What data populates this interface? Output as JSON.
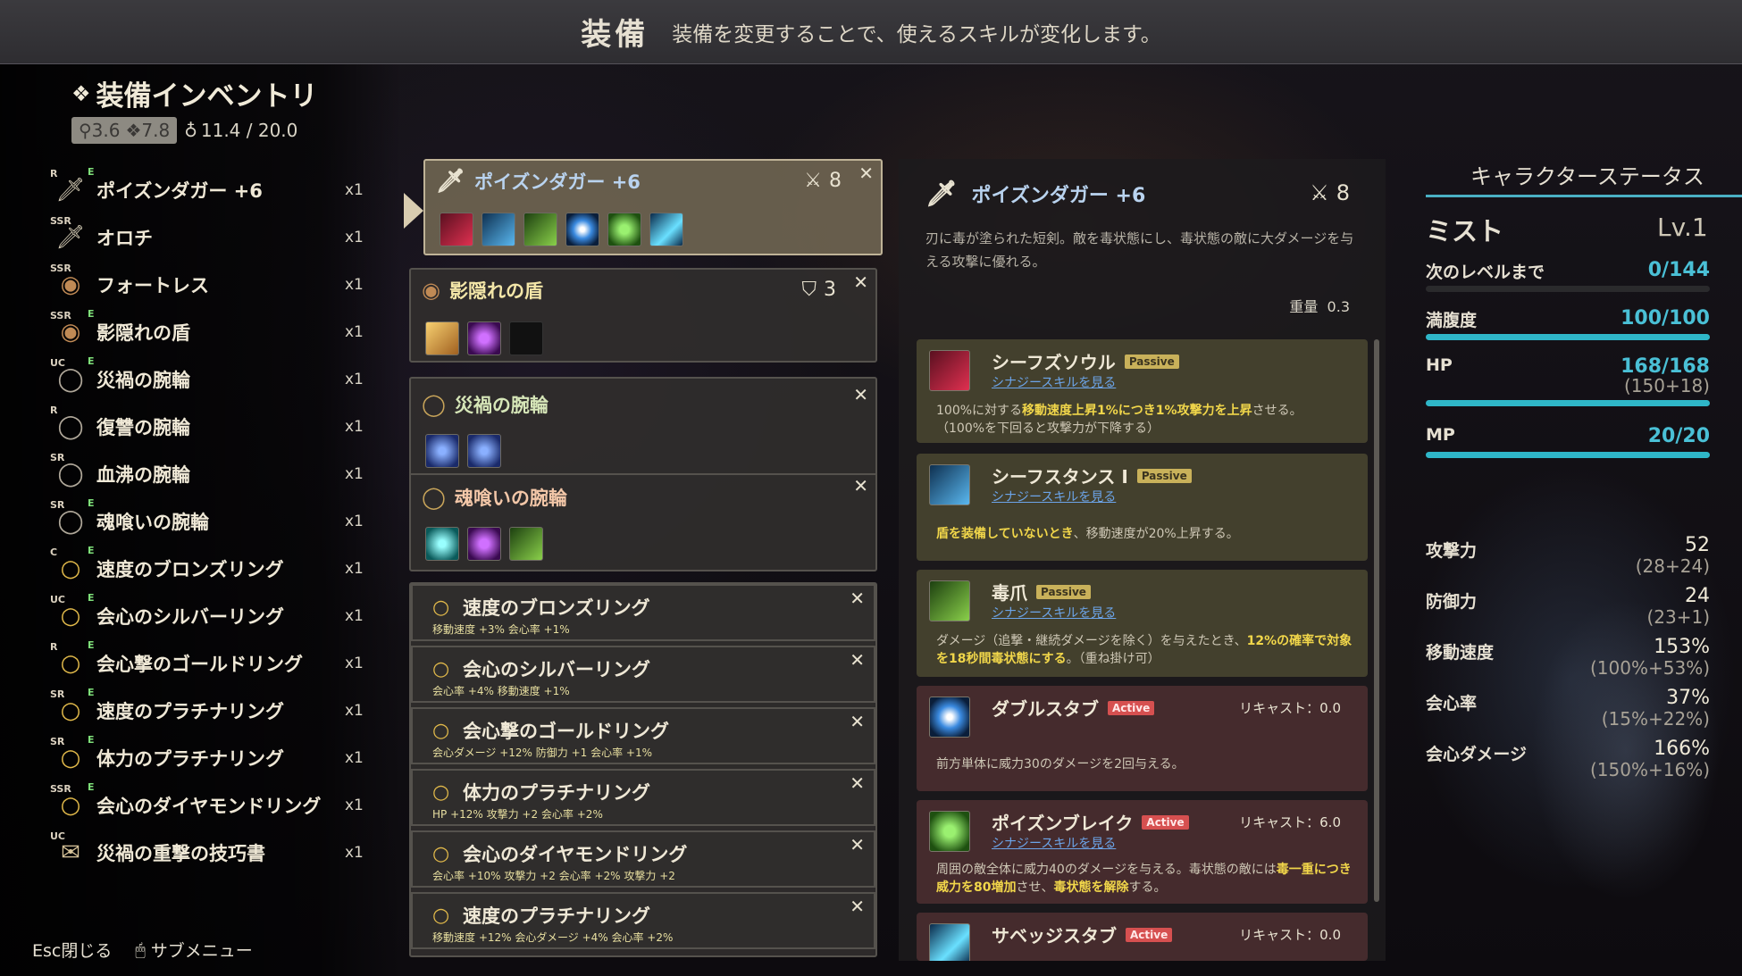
{
  "header": {
    "title": "装備",
    "description": "装備を変更することで、使えるスキルが変化します。"
  },
  "inventory": {
    "title": "装備インベントリ",
    "stat_attack": "3.6",
    "stat_defense": "7.8",
    "weight": "11.4 / 20.0",
    "items": [
      {
        "rarity": "R",
        "name": "ポイズンダガー +6",
        "qty": "x1",
        "icon": "dagger-icon",
        "equipped": "E"
      },
      {
        "rarity": "SSR",
        "name": "オロチ",
        "qty": "x1",
        "icon": "dagger-icon",
        "equipped": ""
      },
      {
        "rarity": "SSR",
        "name": "フォートレス",
        "qty": "x1",
        "icon": "shield-icon",
        "equipped": ""
      },
      {
        "rarity": "SSR",
        "name": "影隠れの盾",
        "qty": "x1",
        "icon": "shield-icon",
        "equipped": "E"
      },
      {
        "rarity": "UC",
        "name": "災禍の腕輪",
        "qty": "x1",
        "icon": "bracelet-icon",
        "equipped": "E"
      },
      {
        "rarity": "R",
        "name": "復讐の腕輪",
        "qty": "x1",
        "icon": "bracelet-icon",
        "equipped": ""
      },
      {
        "rarity": "SR",
        "name": "血沸の腕輪",
        "qty": "x1",
        "icon": "bracelet-icon",
        "equipped": ""
      },
      {
        "rarity": "SR",
        "name": "魂喰いの腕輪",
        "qty": "x1",
        "icon": "bracelet-icon",
        "equipped": "E"
      },
      {
        "rarity": "C",
        "name": "速度のブロンズリング",
        "qty": "x1",
        "icon": "ring-icon",
        "equipped": "E"
      },
      {
        "rarity": "UC",
        "name": "会心のシルバーリング",
        "qty": "x1",
        "icon": "ring-icon",
        "equipped": "E"
      },
      {
        "rarity": "R",
        "name": "会心撃のゴールドリング",
        "qty": "x1",
        "icon": "ring-icon",
        "equipped": "E"
      },
      {
        "rarity": "SR",
        "name": "速度のプラチナリング",
        "qty": "x1",
        "icon": "ring-icon",
        "equipped": "E"
      },
      {
        "rarity": "SR",
        "name": "体力のプラチナリング",
        "qty": "x1",
        "icon": "ring-icon",
        "equipped": "E"
      },
      {
        "rarity": "SSR",
        "name": "会心のダイヤモンドリング",
        "qty": "x1",
        "icon": "ring-icon",
        "equipped": "E"
      },
      {
        "rarity": "UC",
        "name": "災禍の重撃の技巧書",
        "qty": "x1",
        "icon": "scroll-icon",
        "equipped": ""
      }
    ]
  },
  "footer": {
    "close": "Esc閉じる",
    "submenu": "サブメニュー"
  },
  "slots": {
    "weapon": {
      "name": "ポイズンダガー +6",
      "stat": "8"
    },
    "shield": {
      "name": "影隠れの盾",
      "stat": "3"
    },
    "bracelet1": {
      "name": "災禍の腕輪"
    },
    "bracelet2": {
      "name": "魂喰いの腕輪"
    },
    "rings": [
      {
        "name": "速度のブロンズリング",
        "mods": "移動速度 +3%  会心率 +1%"
      },
      {
        "name": "会心のシルバーリング",
        "mods": "会心率 +4%  移動速度 +1%"
      },
      {
        "name": "会心撃のゴールドリング",
        "mods": "会心ダメージ +12%  防御力 +1  会心率 +1%"
      },
      {
        "name": "体力のプラチナリング",
        "mods": "HP +12%  攻撃力 +2  会心率 +2%"
      },
      {
        "name": "会心のダイヤモンドリング",
        "mods": "会心率 +10%  攻撃力 +2  会心率 +2%  攻撃力 +2"
      },
      {
        "name": "速度のプラチナリング",
        "mods": "移動速度 +12%  会心ダメージ +4%  会心率 +2%"
      }
    ]
  },
  "detail": {
    "name": "ポイズンダガー +6",
    "stat": "8",
    "description": "刃に毒が塗られた短剣。敵を毒状態にし、毒状態の敵に大ダメージを与える攻撃に優れる。",
    "weight_label": "重量",
    "weight": "0.3",
    "synergy": "シナジースキルを見る",
    "skills": [
      {
        "name": "シーフズソウル",
        "type": "Passive",
        "text_a": "100%に対する",
        "text_b": "移動速度上昇1%につき1%攻撃力を上昇",
        "text_c": "させる。",
        "text_d": "（100%を下回ると攻撃力が下降する）"
      },
      {
        "name": "シーフスタンス Ⅰ",
        "type": "Passive",
        "text_a": "盾を装備していないとき",
        "text_b": "、移動速度が20%上昇する。"
      },
      {
        "name": "毒爪",
        "type": "Passive",
        "text_a": "ダメージ（追撃・継続ダメージを除く）を与えたとき、",
        "text_b": "12%の確率で対象を18秒間毒状態にする",
        "text_c": "。（重ね掛け可）"
      },
      {
        "name": "ダブルスタブ",
        "type": "Active",
        "recast": "リキャスト：0.0",
        "text_a": "前方単体に威力30のダメージを2回与える。"
      },
      {
        "name": "ポイズンブレイク",
        "type": "Active",
        "recast": "リキャスト：6.0",
        "text_a": "周囲の敵全体に威力40のダメージを与える。毒状態の敵には",
        "text_b": "毒一重につき威力を80増加",
        "text_c": "させ、",
        "text_d": "毒状態を解除",
        "text_e": "する。"
      },
      {
        "name": "サベッジスタブ",
        "type": "Active",
        "recast": "リキャスト：0.0"
      }
    ]
  },
  "status": {
    "title": "キャラクターステータス",
    "name": "ミスト",
    "level": "Lv.1",
    "next_label": "次のレベルまで",
    "next_value": "0/144",
    "next_fill": 0,
    "hunger_label": "満腹度",
    "hunger_value": "100/100",
    "hunger_fill": 1,
    "hp_label": "HP",
    "hp_value": "168/168",
    "hp_sub": "(150+18)",
    "hp_fill": 1,
    "mp_label": "MP",
    "mp_value": "20/20",
    "mp_fill": 1,
    "combat": [
      {
        "label": "攻撃力",
        "value": "52",
        "sub": "(28+24)"
      },
      {
        "label": "防御力",
        "value": "24",
        "sub": "(23+1)"
      },
      {
        "label": "移動速度",
        "value": "153%",
        "sub": "(100%+53%)"
      },
      {
        "label": "会心率",
        "value": "37%",
        "sub": "(15%+22%)"
      },
      {
        "label": "会心ダメージ",
        "value": "166%",
        "sub": "(150%+16%)"
      }
    ]
  }
}
